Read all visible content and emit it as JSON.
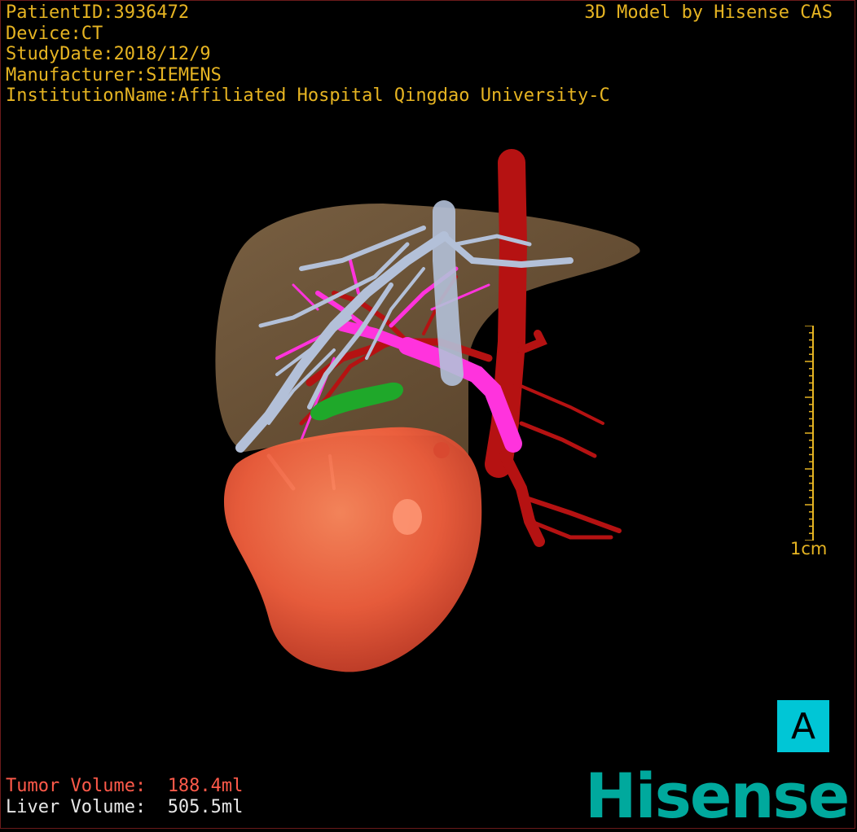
{
  "header": {
    "patient_id": "PatientID:3936472",
    "device": "Device:CT",
    "study_date": "StudyDate:2018/12/9",
    "manufacturer": "Manufacturer:SIEMENS",
    "institution": "InstitutionName:Affiliated Hospital Qingdao University-C",
    "model_credit": "3D Model by Hisense CAS"
  },
  "scale_bar": {
    "label": "1cm"
  },
  "orientation": {
    "label": "A"
  },
  "volumes": {
    "tumor_label": "Tumor Volume:",
    "tumor_value": "188.4ml",
    "liver_label": "Liver Volume:",
    "liver_value": "505.5ml"
  },
  "logo": {
    "text": "Hisense"
  },
  "colors": {
    "overlay_text": "#e6b422",
    "tumor_text": "#ff5a4a",
    "orientation_box": "#00c6d6",
    "logo": "#00a99d",
    "liver": "#8a6a46",
    "tumor": "#f26040",
    "hepatic_vein": "#aebcd4",
    "portal_vein": "#ff33dd",
    "artery": "#b81010",
    "gallbladder": "#1fa82a"
  }
}
